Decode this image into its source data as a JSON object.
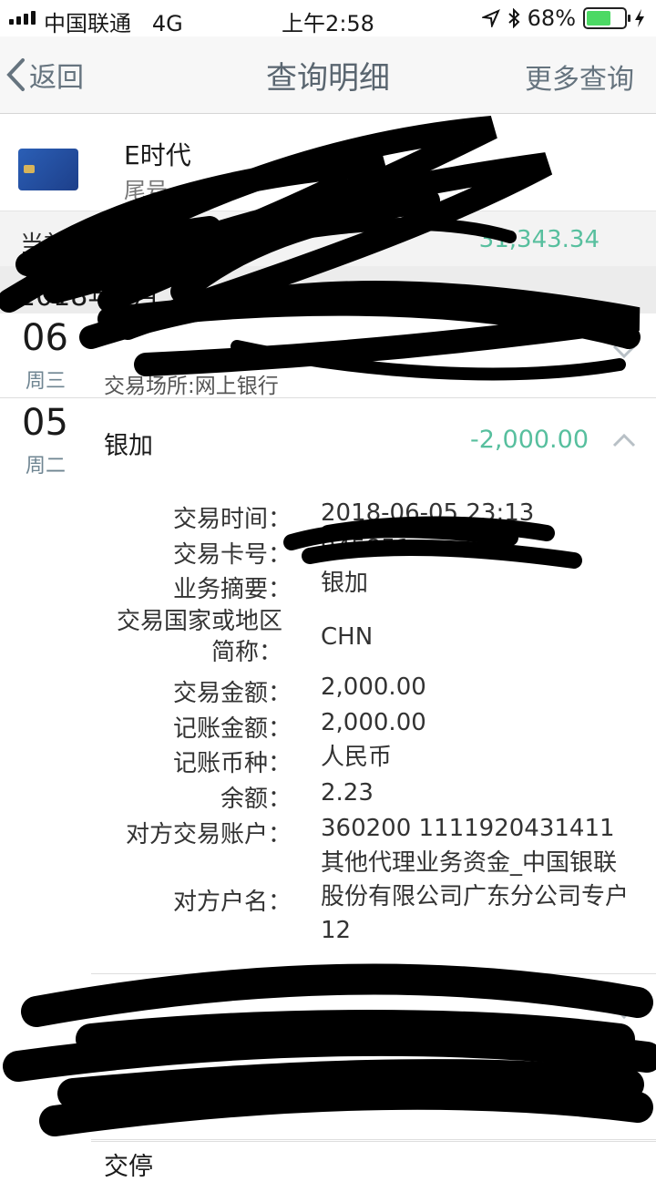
{
  "status_bar": {
    "carrier": "中国联通",
    "network": "4G",
    "time": "上午2:58",
    "battery": "68%"
  },
  "nav": {
    "back_label": "返回",
    "title": "查询明细",
    "more_label": "更多查询"
  },
  "card": {
    "name": "E时代",
    "sub": "尾号"
  },
  "balance": {
    "label": "当前人民币",
    "amount": "31,343.34"
  },
  "month": {
    "label": "2018年6月"
  },
  "transactions": [
    {
      "day": "06",
      "weekday": "周三",
      "name": "",
      "place": "交易场所:网上银行",
      "amount": ""
    },
    {
      "day": "05",
      "weekday": "周二",
      "name": "银加",
      "amount": "-2,000.00"
    }
  ],
  "details": {
    "time_label": "交易时间：",
    "time_value": "2018-06-05 23:13",
    "card_label": "交易卡号：",
    "card_value": "945851",
    "summary_label": "业务摘要：",
    "summary_value": "银加",
    "country_label": "交易国家或地区简称：",
    "country_value": "CHN",
    "txn_amount_label": "交易金额：",
    "txn_amount_value": "2,000.00",
    "post_amount_label": "记账金额：",
    "post_amount_value": "2,000.00",
    "currency_label": "记账币种：",
    "currency_value": "人民币",
    "balance_label": "余额：",
    "balance_value": "2.23",
    "counter_account_label": "对方交易账户：",
    "counter_account_value": "360200 1111920431411",
    "counter_name_label": "对方户名：",
    "counter_name_value": "其他代理业务资金_中国银联股份有限公司广东分公司专户12"
  },
  "bottom_peek": "交停"
}
